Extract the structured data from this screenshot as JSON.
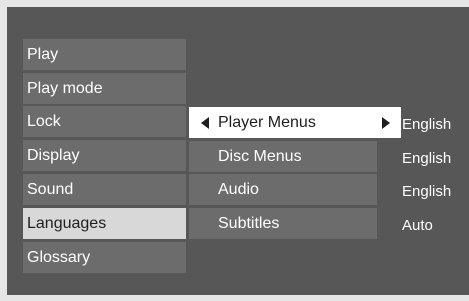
{
  "main_menu": {
    "items": [
      {
        "label": "Play"
      },
      {
        "label": "Play mode"
      },
      {
        "label": "Lock"
      },
      {
        "label": "Display"
      },
      {
        "label": "Sound"
      },
      {
        "label": "Languages",
        "selected": true
      },
      {
        "label": "Glossary"
      }
    ]
  },
  "languages_submenu": {
    "items": [
      {
        "label": "Player Menus",
        "value": "English",
        "selected": true
      },
      {
        "label": "Disc Menus",
        "value": "English"
      },
      {
        "label": "Audio",
        "value": "English"
      },
      {
        "label": "Subtitles",
        "value": "Auto"
      }
    ]
  },
  "colors": {
    "panel": "#575757",
    "item": "#6c6c6c",
    "selected_main": "#d8d8d8",
    "selected_sub": "#ffffff"
  },
  "icons": [
    "arrow-left-icon",
    "arrow-right-icon"
  ]
}
